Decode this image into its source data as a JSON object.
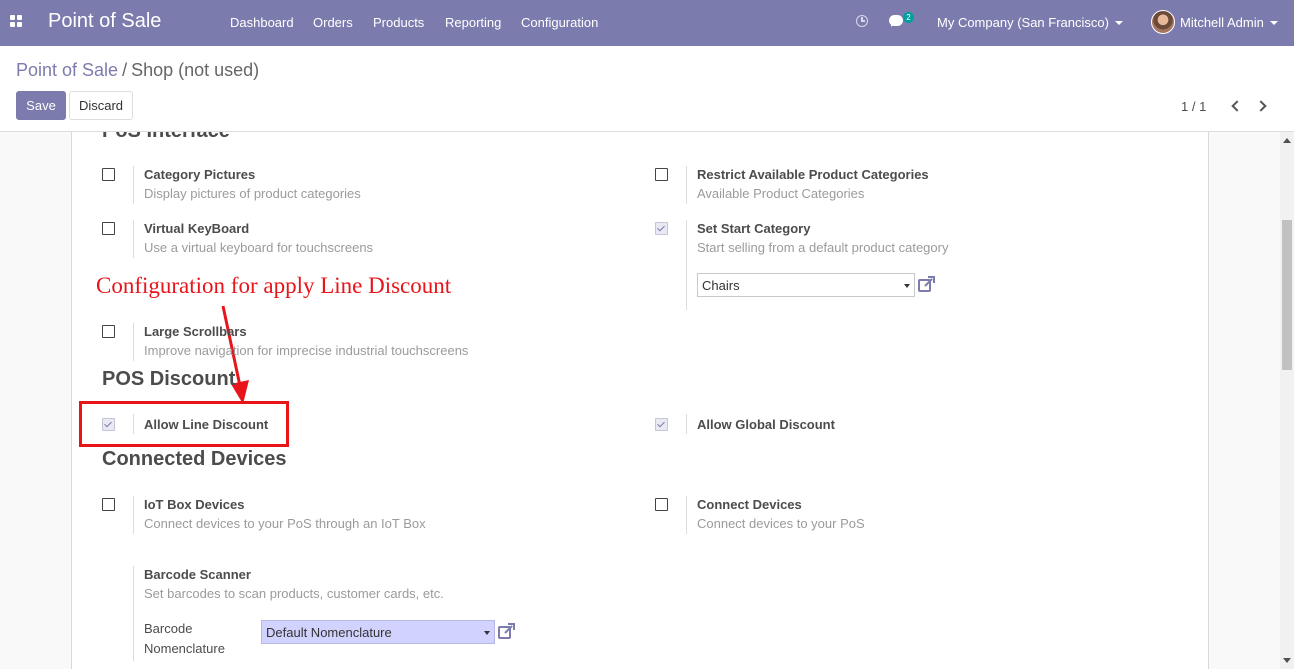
{
  "navbar": {
    "brand": "Point of Sale",
    "menu": [
      "Dashboard",
      "Orders",
      "Products",
      "Reporting",
      "Configuration"
    ],
    "message_count": "2",
    "company": "My Company (San Francisco)",
    "user": "Mitchell Admin",
    "accent_color": "#7c7bad"
  },
  "breadcrumb": {
    "parent": "Point of Sale",
    "separator": "/",
    "current": "Shop (not used)"
  },
  "buttons": {
    "save": "Save",
    "discard": "Discard"
  },
  "pager": {
    "value": "1 / 1"
  },
  "sections": {
    "pos_interface": "PoS Interface",
    "pos_discount": "POS Discount",
    "connected_devices": "Connected Devices"
  },
  "options": {
    "category_pictures": {
      "title": "Category Pictures",
      "desc": "Display pictures of product categories",
      "checked": false
    },
    "restrict_categories": {
      "title": "Restrict Available Product Categories",
      "desc": "Available Product Categories",
      "checked": false
    },
    "virtual_keyboard": {
      "title": "Virtual KeyBoard",
      "desc": "Use a virtual keyboard for touchscreens",
      "checked": false
    },
    "start_category": {
      "title": "Set Start Category",
      "desc": "Start selling from a default product category",
      "checked": true,
      "value": "Chairs"
    },
    "large_scrollbars": {
      "title": "Large Scrollbars",
      "desc": "Improve navigation for imprecise industrial touchscreens",
      "checked": false
    },
    "line_discount": {
      "title": "Allow Line Discount",
      "checked": true
    },
    "global_discount": {
      "title": "Allow Global Discount",
      "checked": true
    },
    "iot_box": {
      "title": "IoT Box Devices",
      "desc": "Connect devices to your PoS through an IoT Box",
      "checked": false
    },
    "connect_devices": {
      "title": "Connect Devices",
      "desc": "Connect devices to your PoS",
      "checked": false
    },
    "barcode_scanner": {
      "title": "Barcode Scanner",
      "desc": "Set barcodes to scan products, customer cards, etc.",
      "field_label_1": "Barcode",
      "field_label_2": "Nomenclature",
      "value": "Default Nomenclature"
    }
  },
  "annotation": {
    "text": "Configuration for apply Line Discount",
    "color": "#e8141a"
  }
}
